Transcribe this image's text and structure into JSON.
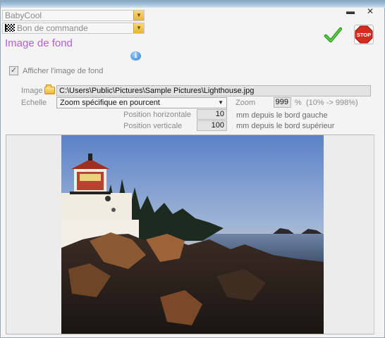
{
  "window": {
    "minimize_glyph": "▬",
    "close_glyph": "✕"
  },
  "header": {
    "app_combo": "BabyCool",
    "doc_combo": "Bon de commande",
    "section_title": "Image de fond"
  },
  "actions": {
    "ok_icon": "checkmark-icon",
    "stop_icon": "stop-sign-icon",
    "stop_label": "STOP",
    "info_icon": "info-icon"
  },
  "form": {
    "show_image_checked": true,
    "show_image_label": "Afficher l'image de fond",
    "image_label": "Image",
    "image_path": "C:\\Users\\Public\\Pictures\\Sample Pictures\\Lighthouse.jpg",
    "scale_label": "Echelle",
    "scale_value": "Zoom spécifique en pourcent",
    "zoom_label": "Zoom",
    "zoom_value": "999",
    "zoom_unit": "%",
    "zoom_range": "(10% -> 998%)",
    "pos_h_label": "Position horizontale",
    "pos_h_value": "10",
    "pos_h_desc": "mm depuis le bord gauche",
    "pos_v_label": "Position verticale",
    "pos_v_value": "100",
    "pos_v_desc": "mm depuis le bord supérieur"
  },
  "preview": {
    "image_name": "lighthouse-photo"
  },
  "colors": {
    "title_purple": "#b45dd8",
    "combo_arrow": "#e9b23a",
    "ok_green": "#2e9e1e",
    "stop_red": "#d62b1f"
  }
}
